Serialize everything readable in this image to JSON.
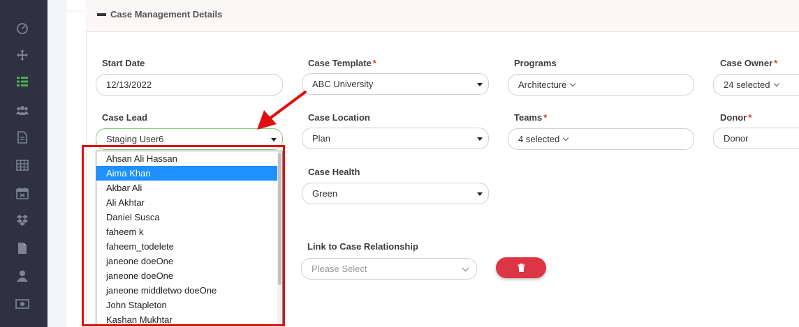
{
  "sidebar": {
    "icons": [
      "dashboard-icon",
      "move-icon",
      "list-icon",
      "users-icon",
      "document-icon",
      "table-icon",
      "calendar-icon",
      "dropbox-icon",
      "file-icon",
      "user-icon",
      "money-icon"
    ]
  },
  "section": {
    "title": "Case Management Details"
  },
  "fields": {
    "start_date": {
      "label": "Start Date",
      "value": "12/13/2022"
    },
    "case_template": {
      "label": "Case Template",
      "required": "*",
      "value": "ABC University"
    },
    "programs": {
      "label": "Programs",
      "value": "Architecture"
    },
    "case_owner": {
      "label": "Case Owner",
      "required": "*",
      "value": "24 selected"
    },
    "case_lead": {
      "label": "Case Lead",
      "value": "Staging User6"
    },
    "case_location": {
      "label": "Case Location",
      "value": "Plan"
    },
    "teams": {
      "label": "Teams",
      "required": "*",
      "value": "4 selected"
    },
    "donor": {
      "label": "Donor",
      "required": "*",
      "value": "Donor"
    },
    "case_health": {
      "label": "Case Health",
      "value": "Green"
    },
    "link_relationship": {
      "label": "Link to Case Relationship",
      "placeholder": "Please Select"
    }
  },
  "case_lead_options": {
    "items": [
      "Ahsan Ali Hassan",
      "Aima Khan",
      "Akbar Ali",
      "Ali Akhtar",
      "Daniel Susca",
      "faheem k",
      "faheem_todelete",
      "janeone doeOne",
      "janeone doeOne",
      "janeone middletwo doeOne",
      "John Stapleton",
      "Kashan Mukhtar"
    ],
    "selected_index": 1
  },
  "colors": {
    "sidebar": "#2c3240",
    "sidebar_active": "#4caf50",
    "required": "#e3342f",
    "selected": "#1e90ff",
    "delete": "#dc3545",
    "highlight": "#e01010"
  }
}
